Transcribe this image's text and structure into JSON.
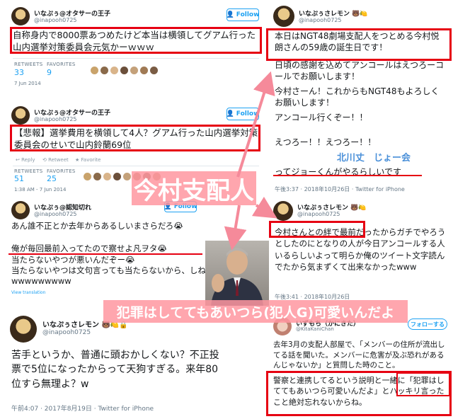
{
  "tweet1": {
    "name": "いなぷぅ@オタサーの王子",
    "handle": "@inapooh0725",
    "follow": "Follow",
    "text": "自称身内で8000票あつめたけど本当は横領してグアム行った山内選挙対策委員会元気かーｗｗｗ",
    "retweets_label": "RETWEETS",
    "retweets": "33",
    "favorites_label": "FAVORITES",
    "favorites": "9",
    "time": "7 Jun 2014"
  },
  "tweet2": {
    "name": "いなぷぅ@オタサーの王子",
    "handle": "@inapooh0725",
    "follow": "Follow",
    "text": "【悲報】選挙費用を横領して4人？グアム行った山内選挙対策委員会のせいで山内鈴蘭69位",
    "reply": "Reply",
    "retweet": "Retweet",
    "favorite": "Favorite",
    "retweets_label": "RETWEETS",
    "retweets": "51",
    "favorites_label": "FAVORITES",
    "favorites": "25",
    "time": "1:38 AM - 7 Jun 2014"
  },
  "tweet3": {
    "name": "いなぷぅ@認知切れ",
    "handle": "@inapooh0725",
    "follow": "Follow",
    "lines": [
      "あん誰不正とか去年からあるしいまさらだろ😭",
      "俺が毎回最前入ってたので察せよ凡ヲタ😭",
      "当たらないやつが悪いんだぞー😭",
      "当たらないやつは文句言っても当たらないから、しねーwwwwwwwww"
    ],
    "translation": "View translation"
  },
  "tweet4": {
    "name": "いなぷぅさレモン",
    "handle": "@inapooh0725",
    "text": "苦手というか、普通に頭おかしくない？不正投票で5位になったからって天狗すぎる。来年80位すら無理よ？w",
    "time": "午前4:07 · 2017年8月19日 · Twitter for iPhone"
  },
  "tweet5": {
    "name": "いなぷぅさレモン",
    "handle": "@inapooh0725",
    "lines": [
      "本日はNGT48劇場支配人をつとめる今村悦朗さんの59歳の誕生日です！",
      "日頃の感謝を込めてアンコールはえつろーコールでお願いします！",
      "今村さーん！これからもNGT48もよろしくお願いします！",
      "アンコール行くぞー！！",
      "",
      "えつろー！！えつろー！！",
      "",
      "ってジョーくんがやるらしいです"
    ],
    "time": "午後3:37 · 2018年10月26日 · Twitter for iPhone"
  },
  "tweet6": {
    "name": "いなぷぅさレモン",
    "handle": "@inapooh0725",
    "text": "今村さんとの絆で最前だったからガチでやろうとしたのにとなりの人が今日アンコールする人いるらしいよって明らか俺のツイート文字読んでたから気まずくて出来なかったwww",
    "time": "午後3:41 · 2018年10月26日"
  },
  "tweet7": {
    "name": "いずもち（かにきた）",
    "handle": "@KitaKaniChan",
    "follow": "フォローする",
    "text": "去年3月の支配人部屋で、「メンバーの住所が流出してる話を聞いた。メンバーに危害が及ぶ恐れがあるんじゃないか」と質問した時のこと。",
    "quote": "警察と連携してるという説明と一緒に「犯罪はしててもあいつら可愛いんだよ」とハッキリ言ったこと絶対忘れないからね。"
  },
  "overlays": {
    "manager_label": "今村支配人",
    "quote_label": "犯罪はしててもあいつら(犯人G)可愛いんだよ",
    "names_label": "北川丈　じょー会"
  },
  "colors": {
    "accent": "#1da1f2",
    "highlight": "#e60012",
    "pink": "#ff96a0"
  }
}
